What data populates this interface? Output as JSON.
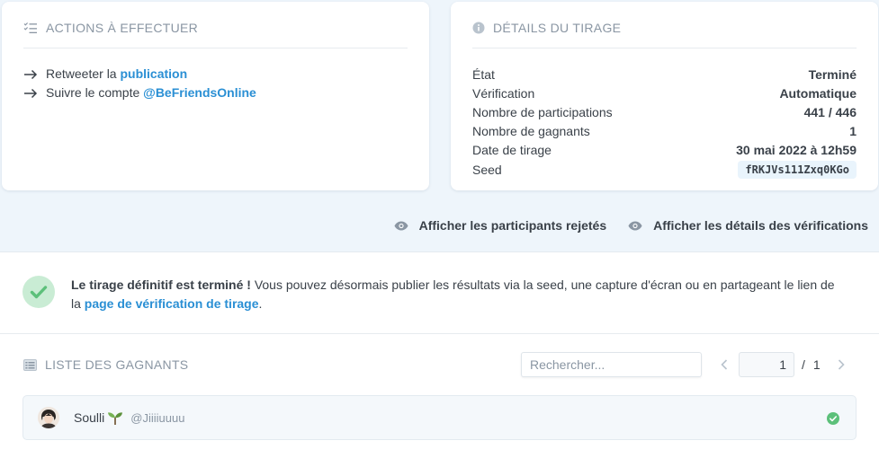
{
  "actions": {
    "title": "ACTIONS À EFFECTUER",
    "items": [
      {
        "prefix": "Retweeter la",
        "link": "publication"
      },
      {
        "prefix": "Suivre le compte",
        "link": "@BeFriendsOnline"
      }
    ]
  },
  "details": {
    "title": "DÉTAILS DU TIRAGE",
    "rows": [
      {
        "label": "État",
        "value": "Terminé"
      },
      {
        "label": "Vérification",
        "value": "Automatique"
      },
      {
        "label": "Nombre de participations",
        "value": "441 / 446"
      },
      {
        "label": "Nombre de gagnants",
        "value": "1"
      },
      {
        "label": "Date de tirage",
        "value": "30 mai 2022 à 12h59"
      },
      {
        "label": "Seed",
        "value": "fRKJVs111Zxq0KGo"
      }
    ]
  },
  "toggles": {
    "rejected": "Afficher les participants rejetés",
    "verifications": "Afficher les détails des vérifications"
  },
  "notice": {
    "bold": "Le tirage définitif est terminé !",
    "text": " Vous pouvez désormais publier les résultats via la seed, une capture d'écran ou en partageant le lien de la ",
    "link": "page de vérification de tirage",
    "end": "."
  },
  "winners": {
    "title": "LISTE DES GAGNANTS",
    "search_placeholder": "Rechercher...",
    "page_current": "1",
    "page_sep": "/",
    "page_total": "1",
    "items": [
      {
        "name": "Soulli",
        "handle": "@Jiiiiuuuu"
      }
    ]
  },
  "colors": {
    "accent": "#2a8fd4",
    "success": "#5cc07a",
    "muted": "#8a96a3"
  }
}
